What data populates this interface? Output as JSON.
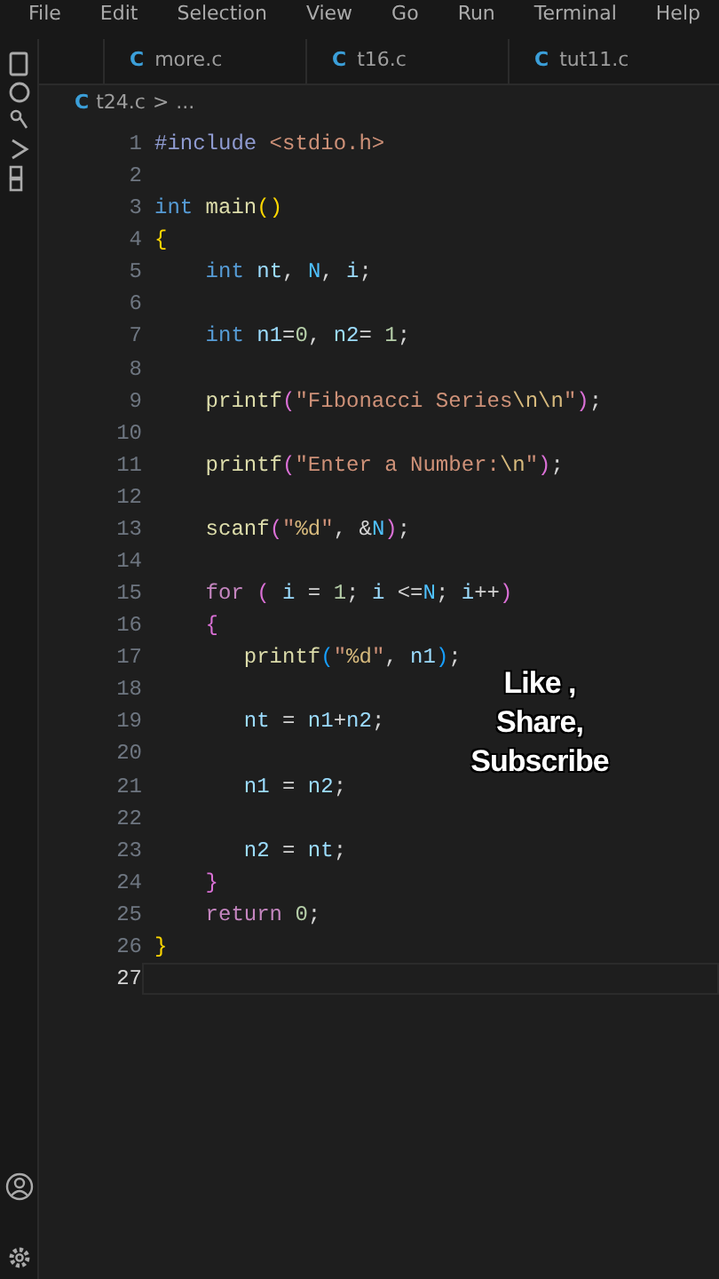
{
  "menu_bar": [
    "File",
    "Edit",
    "Selection",
    "View",
    "Go",
    "Run",
    "Terminal",
    "Help"
  ],
  "tabs": [
    {
      "icon_text": "C",
      "label": "more.c"
    },
    {
      "icon_text": "C",
      "label": "t16.c"
    },
    {
      "icon_text": "C",
      "label": "tut11.c"
    }
  ],
  "breadcrumb": {
    "icon_text": "C",
    "file": "t24.c",
    "separator": ">",
    "rest": "..."
  },
  "editor": {
    "lines": [
      {
        "number": "1",
        "current": false,
        "tokens": [
          {
            "kind": "pre",
            "text": "#include"
          },
          {
            "kind": "inc",
            "text": " <stdio.h>"
          }
        ]
      },
      {
        "number": "2",
        "current": false
      },
      {
        "number": "3",
        "current": false,
        "tokens": [
          {
            "kind": "kw",
            "text": "int"
          },
          {
            "kind": "fn",
            "text": " main"
          },
          {
            "kind": "b1",
            "text": "()"
          }
        ]
      },
      {
        "number": "4",
        "current": false,
        "tokens": [
          {
            "kind": "b1",
            "text": "{"
          }
        ]
      },
      {
        "number": "5",
        "current": false,
        "tokens": [
          {
            "kind": "kw",
            "text": "    int"
          },
          {
            "kind": "var",
            "text": " nt"
          },
          {
            "kind": "op",
            "text": ", "
          },
          {
            "kind": "const",
            "text": "N"
          },
          {
            "kind": "op",
            "text": ", "
          },
          {
            "kind": "var",
            "text": "i"
          },
          {
            "kind": "op",
            "text": ";"
          }
        ]
      },
      {
        "number": "6",
        "current": false
      },
      {
        "number": "7",
        "current": false,
        "tokens": [
          {
            "kind": "kw",
            "text": "    int"
          },
          {
            "kind": "var",
            "text": " n1"
          },
          {
            "kind": "op",
            "text": "="
          },
          {
            "kind": "num",
            "text": "0"
          },
          {
            "kind": "op",
            "text": ", "
          },
          {
            "kind": "var",
            "text": "n2"
          },
          {
            "kind": "op",
            "text": "= "
          },
          {
            "kind": "num",
            "text": "1"
          },
          {
            "kind": "op",
            "text": ";"
          }
        ]
      },
      {
        "number": "8",
        "current": false
      },
      {
        "number": "9",
        "current": false,
        "tokens": [
          {
            "kind": "fn",
            "text": "    printf"
          },
          {
            "kind": "b2",
            "text": "("
          },
          {
            "kind": "str",
            "text": "\"Fibonacci Series"
          },
          {
            "kind": "esc",
            "text": "\\n\\n"
          },
          {
            "kind": "str",
            "text": "\""
          },
          {
            "kind": "b2",
            "text": ")"
          },
          {
            "kind": "op",
            "text": ";"
          }
        ]
      },
      {
        "number": "10",
        "current": false
      },
      {
        "number": "11",
        "current": false,
        "tokens": [
          {
            "kind": "fn",
            "text": "    printf"
          },
          {
            "kind": "b2",
            "text": "("
          },
          {
            "kind": "str",
            "text": "\"Enter a Number:"
          },
          {
            "kind": "esc",
            "text": "\\n"
          },
          {
            "kind": "str",
            "text": "\""
          },
          {
            "kind": "b2",
            "text": ")"
          },
          {
            "kind": "op",
            "text": ";"
          }
        ]
      },
      {
        "number": "12",
        "current": false
      },
      {
        "number": "13",
        "current": false,
        "tokens": [
          {
            "kind": "fn",
            "text": "    scanf"
          },
          {
            "kind": "b2",
            "text": "("
          },
          {
            "kind": "str",
            "text": "\""
          },
          {
            "kind": "esc",
            "text": "%d"
          },
          {
            "kind": "str",
            "text": "\""
          },
          {
            "kind": "op",
            "text": ", &"
          },
          {
            "kind": "const",
            "text": "N"
          },
          {
            "kind": "b2",
            "text": ")"
          },
          {
            "kind": "op",
            "text": ";"
          }
        ]
      },
      {
        "number": "14",
        "current": false
      },
      {
        "number": "15",
        "current": false,
        "tokens": [
          {
            "kind": "ctrl",
            "text": "    for"
          },
          {
            "kind": "b2",
            "text": " ("
          },
          {
            "kind": "var",
            "text": " i"
          },
          {
            "kind": "op",
            "text": " = "
          },
          {
            "kind": "num",
            "text": "1"
          },
          {
            "kind": "op",
            "text": "; "
          },
          {
            "kind": "var",
            "text": "i"
          },
          {
            "kind": "op",
            "text": " <="
          },
          {
            "kind": "const",
            "text": "N"
          },
          {
            "kind": "op",
            "text": "; "
          },
          {
            "kind": "var",
            "text": "i"
          },
          {
            "kind": "op",
            "text": "++"
          },
          {
            "kind": "b2",
            "text": ")"
          }
        ]
      },
      {
        "number": "16",
        "current": false,
        "tokens": [
          {
            "kind": "b2",
            "text": "    {"
          }
        ]
      },
      {
        "number": "17",
        "current": false,
        "tokens": [
          {
            "kind": "fn",
            "text": "       printf"
          },
          {
            "kind": "b3",
            "text": "("
          },
          {
            "kind": "str",
            "text": "\""
          },
          {
            "kind": "esc",
            "text": "%d"
          },
          {
            "kind": "str",
            "text": "\""
          },
          {
            "kind": "op",
            "text": ", "
          },
          {
            "kind": "var",
            "text": "n1"
          },
          {
            "kind": "b3",
            "text": ")"
          },
          {
            "kind": "op",
            "text": ";"
          }
        ]
      },
      {
        "number": "18",
        "current": false
      },
      {
        "number": "19",
        "current": false,
        "tokens": [
          {
            "kind": "var",
            "text": "       nt"
          },
          {
            "kind": "op",
            "text": " = "
          },
          {
            "kind": "var",
            "text": "n1"
          },
          {
            "kind": "op",
            "text": "+"
          },
          {
            "kind": "var",
            "text": "n2"
          },
          {
            "kind": "op",
            "text": ";"
          }
        ]
      },
      {
        "number": "20",
        "current": false
      },
      {
        "number": "21",
        "current": false,
        "tokens": [
          {
            "kind": "var",
            "text": "       n1"
          },
          {
            "kind": "op",
            "text": " = "
          },
          {
            "kind": "var",
            "text": "n2"
          },
          {
            "kind": "op",
            "text": ";"
          }
        ]
      },
      {
        "number": "22",
        "current": false
      },
      {
        "number": "23",
        "current": false,
        "tokens": [
          {
            "kind": "var",
            "text": "       n2"
          },
          {
            "kind": "op",
            "text": " = "
          },
          {
            "kind": "var",
            "text": "nt"
          },
          {
            "kind": "op",
            "text": ";"
          }
        ]
      },
      {
        "number": "24",
        "current": false,
        "tokens": [
          {
            "kind": "b2",
            "text": "    }"
          }
        ]
      },
      {
        "number": "25",
        "current": false,
        "tokens": [
          {
            "kind": "ctrl",
            "text": "    return"
          },
          {
            "kind": "num",
            "text": " 0"
          },
          {
            "kind": "op",
            "text": ";"
          }
        ]
      },
      {
        "number": "26",
        "current": false,
        "tokens": [
          {
            "kind": "b1",
            "text": "}"
          }
        ]
      },
      {
        "number": "27",
        "current": true
      }
    ]
  },
  "overlay_caption": [
    "Like ,",
    "Share,",
    "Subscribe"
  ]
}
